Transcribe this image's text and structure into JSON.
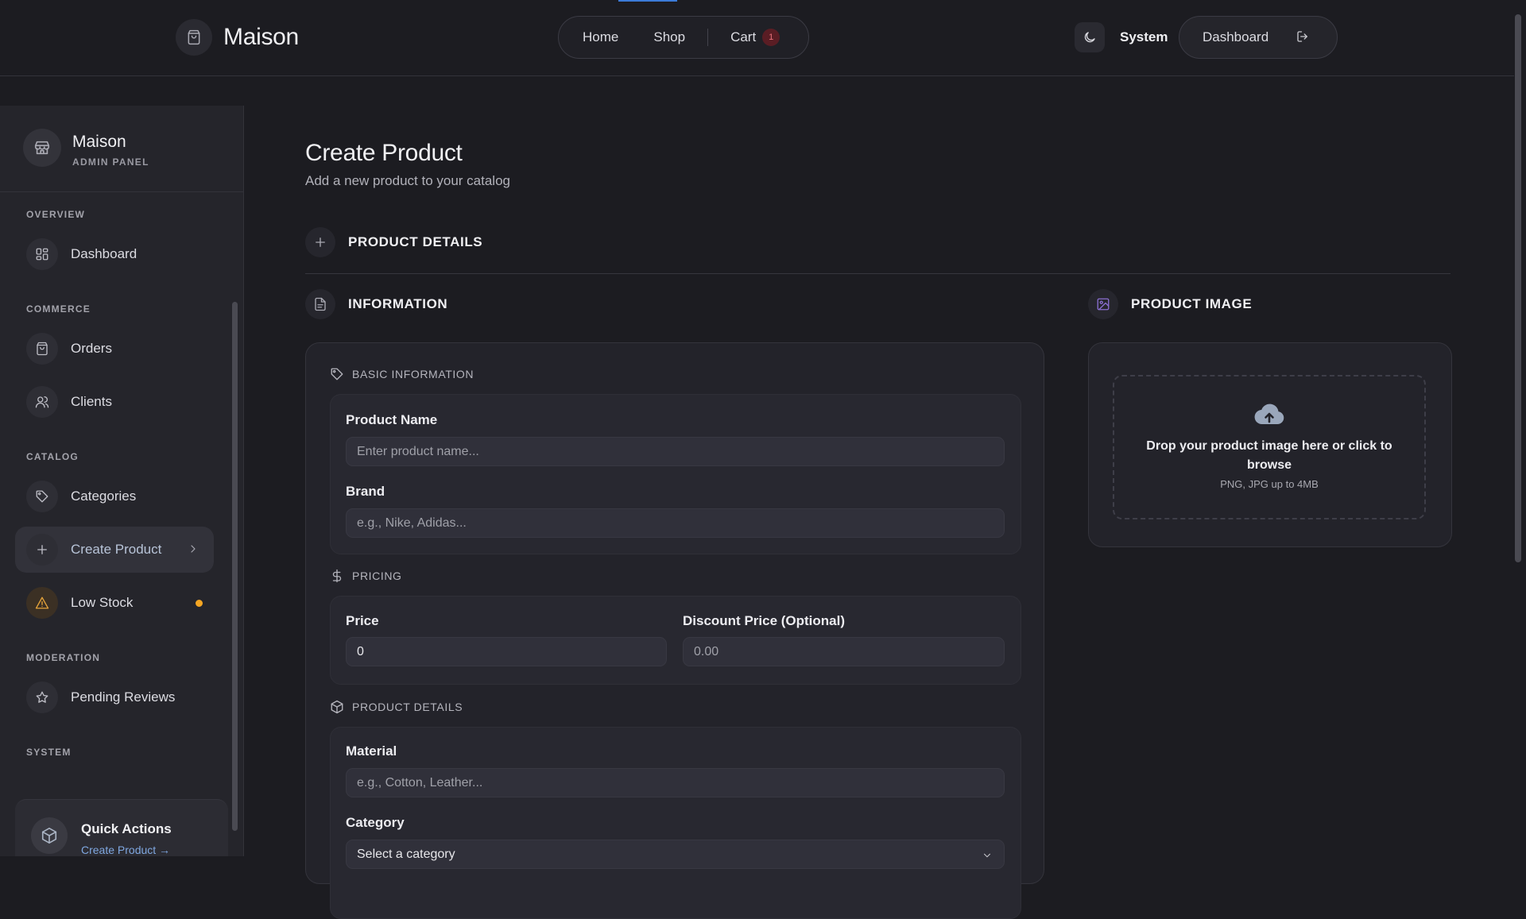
{
  "header": {
    "brand": "Maison",
    "nav": {
      "home": "Home",
      "shop": "Shop",
      "cart": "Cart",
      "cart_count": "1"
    },
    "theme_label": "System",
    "dashboard": "Dashboard"
  },
  "sidebar": {
    "title": "Maison",
    "subtitle": "ADMIN PANEL",
    "sections": {
      "overview": "OVERVIEW",
      "commerce": "COMMERCE",
      "catalog": "CATALOG",
      "moderation": "MODERATION",
      "system": "SYSTEM"
    },
    "items": {
      "dashboard": "Dashboard",
      "orders": "Orders",
      "clients": "Clients",
      "categories": "Categories",
      "create_product": "Create Product",
      "low_stock": "Low Stock",
      "pending_reviews": "Pending Reviews"
    },
    "quick_actions": {
      "title": "Quick Actions",
      "link": "Create Product →"
    }
  },
  "main": {
    "title": "Create Product",
    "subtitle": "Add a new product to your catalog",
    "product_details_header": "PRODUCT DETAILS",
    "information_header": "INFORMATION",
    "product_image_header": "PRODUCT IMAGE",
    "basic": {
      "label": "BASIC INFORMATION",
      "product_name_label": "Product Name",
      "product_name_placeholder": "Enter product name...",
      "brand_label": "Brand",
      "brand_placeholder": "e.g., Nike, Adidas..."
    },
    "pricing": {
      "label": "PRICING",
      "price_label": "Price",
      "price_value": "0",
      "discount_label": "Discount Price (Optional)",
      "discount_placeholder": "0.00"
    },
    "details": {
      "label": "PRODUCT DETAILS",
      "material_label": "Material",
      "material_placeholder": "e.g., Cotton, Leather...",
      "category_label": "Category",
      "category_value": "Select a category"
    },
    "image": {
      "drop_text": "Drop your product image here or click to browse",
      "hint": "PNG, JPG up to 4MB"
    }
  },
  "icons": {
    "brand": "shopping-bag-icon",
    "theme": "moon-icon",
    "logout": "logout-icon",
    "sidebar_logo": "store-icon"
  },
  "colors": {
    "background": "#1c1c21",
    "accent": "#3b7bd8",
    "warning": "#f5a623",
    "badge": "#5a1d24"
  }
}
